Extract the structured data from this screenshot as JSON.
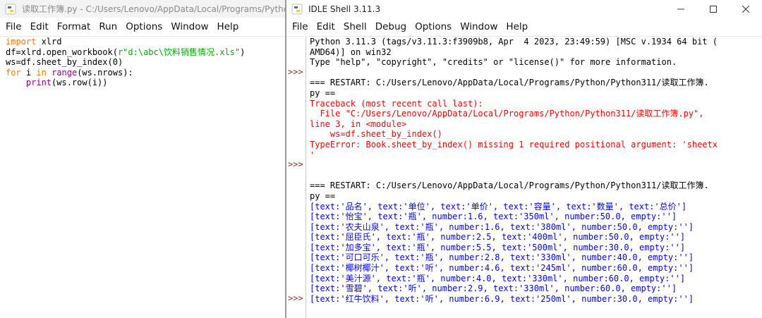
{
  "editor": {
    "title": "读取工作簿.py - C:/Users/Lenovo/AppData/Local/Programs/Pytho",
    "menu": [
      "File",
      "Edit",
      "Format",
      "Run",
      "Options",
      "Window",
      "Help"
    ],
    "code": {
      "l1_kw": "import",
      "l1_rest": " xlrd",
      "l2_a": "df=xlrd.open_workbook(",
      "l2_str": "r\"d:\\abc\\饮料销售情况.xls\"",
      "l2_b": ")",
      "l3": "ws=df.sheet_by_index(0)",
      "l4_kw1": "for",
      "l4_a": " i ",
      "l4_kw2": "in",
      "l4_sp": " ",
      "l4_bi": "range",
      "l4_b": "(ws.nrows):",
      "l5_indent": "    ",
      "l5_bi": "print",
      "l5_rest": "(ws.row(i))"
    }
  },
  "shell": {
    "title": "IDLE Shell 3.11.3",
    "menu": [
      "File",
      "Edit",
      "Shell",
      "Debug",
      "Options",
      "Window",
      "Help"
    ],
    "prompt": ">>>",
    "lines": [
      "Python 3.11.3 (tags/v3.11.3:f3909b8, Apr  4 2023, 23:49:59) [MSC v.1934 64 bit (",
      "AMD64)] on win32",
      "Type \"help\", \"copyright\", \"credits\" or \"license()\" for more information.",
      "",
      "=== RESTART: C:/Users/Lenovo/AppData/Local/Programs/Python/Python311/读取工作簿.",
      "py ==",
      "Traceback (most recent call last):",
      "  File \"C:/Users/Lenovo/AppData/Local/Programs/Python/Python311/读取工作簿.py\",",
      "line 3, in <module>",
      "    ws=df.sheet_by_index()",
      "TypeError: Book.sheet_by_index() missing 1 required positional argument: 'sheetx",
      "'",
      "",
      "",
      "=== RESTART: C:/Users/Lenovo/AppData/Local/Programs/Python/Python311/读取工作簿.",
      "py ==",
      "[text:'品名', text:'单位', text:'单价', text:'容量', text:'数量', text:'总价']",
      "[text:'怡宝', text:'瓶', number:1.6, text:'350ml', number:50.0, empty:'']",
      "[text:'农夫山泉', text:'瓶', number:1.6, text:'380ml', number:50.0, empty:'']",
      "[text:'屈臣氏', text:'瓶', number:2.5, text:'400ml', number:50.0, empty:'']",
      "[text:'加多宝', text:'瓶', number:5.5, text:'500ml', number:30.0, empty:'']",
      "[text:'可口可乐', text:'瓶', number:2.8, text:'330ml', number:40.0, empty:'']",
      "[text:'椰树椰汁', text:'听', number:4.6, text:'245ml', number:60.0, empty:'']",
      "[text:'美汁源', text:'瓶', number:4.0, text:'330ml', number:60.0, empty:'']",
      "[text:'雪碧', text:'听', number:2.9, text:'330ml', number:60.0, empty:'']",
      "[text:'红牛饮料', text:'听', number:6.9, text:'250ml', number:30.0, empty:'']"
    ]
  }
}
